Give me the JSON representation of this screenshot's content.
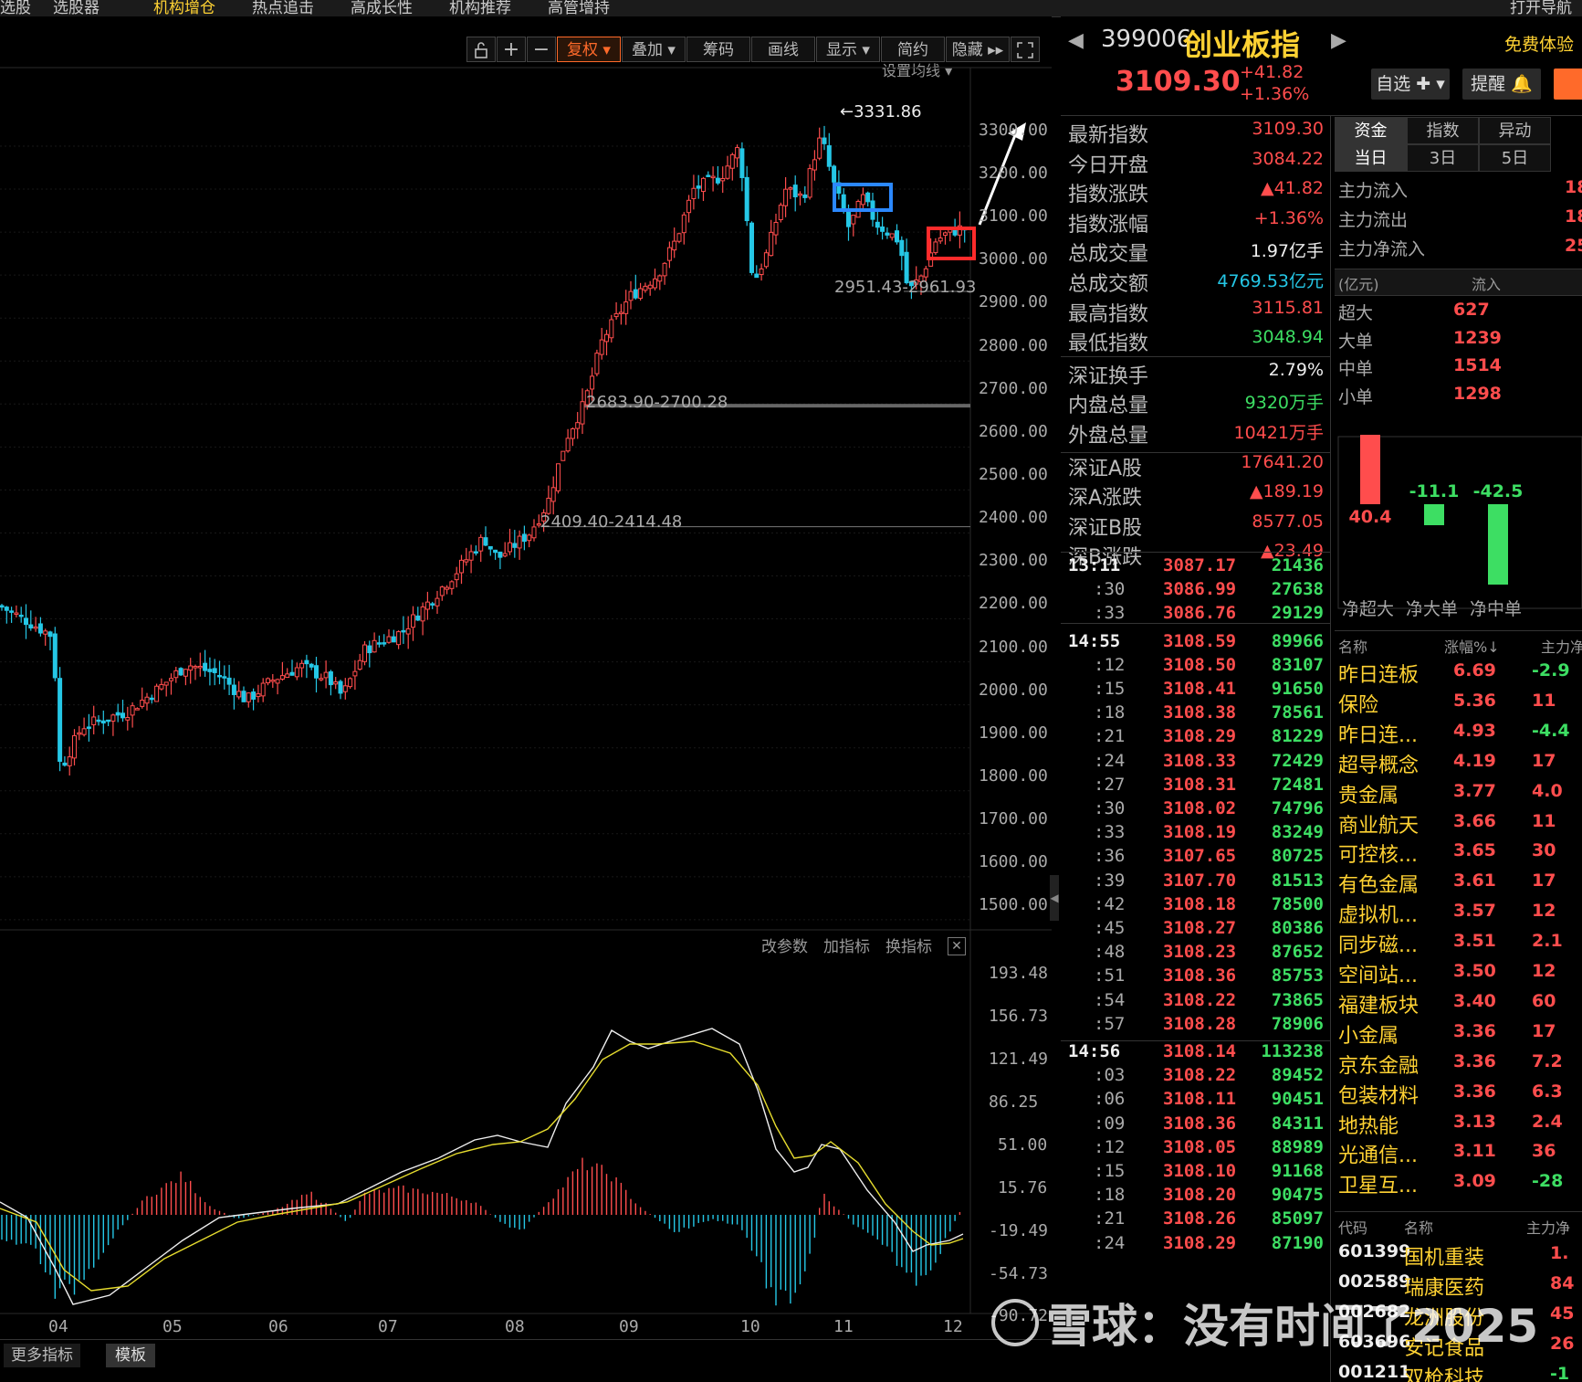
{
  "topnav": {
    "items": [
      "选股",
      "选股器",
      "机构增仓",
      "热点追击",
      "高成长性",
      "机构推荐",
      "高管增持"
    ],
    "right": "打开导航"
  },
  "toolbar": {
    "buttons": [
      "复权",
      "叠加",
      "筹码",
      "画线",
      "显示",
      "简约",
      "隐藏"
    ]
  },
  "chart": {
    "set_ma_label": "设置均线",
    "high_annot": "3331.86",
    "gap1": "2951.43-2961.93",
    "gap2": "2683.90-2700.28",
    "gap3": "2409.40-2414.48",
    "price_ticks": [
      "3300.00",
      "3200.00",
      "3100.00",
      "3000.00",
      "2900.00",
      "2800.00",
      "2700.00",
      "2600.00",
      "2500.00",
      "2400.00",
      "2300.00",
      "2200.00",
      "2100.00",
      "2000.00",
      "1900.00",
      "1800.00",
      "1700.00",
      "1600.00",
      "1500.00"
    ],
    "indicator_tools": [
      "改参数",
      "加指标",
      "换指标"
    ],
    "ind_ticks": [
      "193.48",
      "156.73",
      "121.49",
      "86.25",
      "51.00",
      "15.76",
      "-19.49",
      "-54.73",
      "-90.72"
    ],
    "months": [
      "04",
      "05",
      "06",
      "07",
      "08",
      "09",
      "10",
      "11",
      "12"
    ],
    "bottom_tabs": [
      "更多指标",
      "模板"
    ]
  },
  "header": {
    "code": "399006",
    "name": "创业板指",
    "price": "3109.30",
    "change": "+41.82",
    "change_pct": "+1.36%",
    "free_trial": "免费体验",
    "btn_watch": "自选",
    "btn_alert": "提醒"
  },
  "stats": [
    {
      "label": "最新指数",
      "value": "3109.30",
      "color": "red"
    },
    {
      "label": "今日开盘",
      "value": "3084.22",
      "color": "red"
    },
    {
      "label": "指数涨跌",
      "value": "▲41.82",
      "color": "red"
    },
    {
      "label": "指数涨幅",
      "value": "+1.36%",
      "color": "red"
    },
    {
      "label": "总成交量",
      "value": "1.97亿手",
      "color": "white"
    },
    {
      "label": "总成交额",
      "value": "4769.53亿元",
      "color": "cyan"
    },
    {
      "label": "最高指数",
      "value": "3115.81",
      "color": "red"
    },
    {
      "label": "最低指数",
      "value": "3048.94",
      "color": "green"
    },
    {
      "label": "深证换手",
      "value": "2.79%",
      "color": "white"
    },
    {
      "label": "内盘总量",
      "value": "9320万手",
      "color": "green"
    },
    {
      "label": "外盘总量",
      "value": "10421万手",
      "color": "red"
    },
    {
      "label": "深证A股",
      "value": "17641.20",
      "color": "red"
    },
    {
      "label": "深A涨跌",
      "value": "▲189.19",
      "color": "red"
    },
    {
      "label": "深证B股",
      "value": "8577.05",
      "color": "red"
    },
    {
      "label": "深B涨跌",
      "value": "▲23.49",
      "color": "red"
    }
  ],
  "ticks": [
    {
      "t": "13:11",
      "p": "3087.17",
      "v": "21436",
      "hdr": true
    },
    {
      "t": ":30",
      "p": "3086.99",
      "v": "27638"
    },
    {
      "t": ":33",
      "p": "3086.76",
      "v": "29129"
    },
    {
      "t": "14:55",
      "p": "3108.59",
      "v": "89966",
      "hdr": true
    },
    {
      "t": ":12",
      "p": "3108.50",
      "v": "83107"
    },
    {
      "t": ":15",
      "p": "3108.41",
      "v": "91650"
    },
    {
      "t": ":18",
      "p": "3108.38",
      "v": "78561"
    },
    {
      "t": ":21",
      "p": "3108.29",
      "v": "81229"
    },
    {
      "t": ":24",
      "p": "3108.33",
      "v": "72429"
    },
    {
      "t": ":27",
      "p": "3108.31",
      "v": "72481"
    },
    {
      "t": ":30",
      "p": "3108.02",
      "v": "74796"
    },
    {
      "t": ":33",
      "p": "3108.19",
      "v": "83249"
    },
    {
      "t": ":36",
      "p": "3107.65",
      "v": "80725"
    },
    {
      "t": ":39",
      "p": "3107.70",
      "v": "81513"
    },
    {
      "t": ":42",
      "p": "3108.18",
      "v": "78500"
    },
    {
      "t": ":45",
      "p": "3108.27",
      "v": "80386"
    },
    {
      "t": ":48",
      "p": "3108.23",
      "v": "87652"
    },
    {
      "t": ":51",
      "p": "3108.36",
      "v": "85753"
    },
    {
      "t": ":54",
      "p": "3108.22",
      "v": "73865"
    },
    {
      "t": ":57",
      "p": "3108.28",
      "v": "78906"
    },
    {
      "t": "14:56",
      "p": "3108.14",
      "v": "113238",
      "hdr": true
    },
    {
      "t": ":03",
      "p": "3108.22",
      "v": "89452"
    },
    {
      "t": ":06",
      "p": "3108.11",
      "v": "90451"
    },
    {
      "t": ":09",
      "p": "3108.36",
      "v": "84311"
    },
    {
      "t": ":12",
      "p": "3108.05",
      "v": "88989"
    },
    {
      "t": ":15",
      "p": "3108.10",
      "v": "91168"
    },
    {
      "t": ":18",
      "p": "3108.20",
      "v": "90475"
    },
    {
      "t": ":21",
      "p": "3108.26",
      "v": "85097"
    },
    {
      "t": ":24",
      "p": "3108.29",
      "v": "87190"
    }
  ],
  "fund": {
    "tabs": [
      "资金",
      "指数",
      "异动"
    ],
    "period_tabs": [
      "当日",
      "3日",
      "5日"
    ],
    "flow_rows": [
      {
        "label": "主力流入",
        "value": "18"
      },
      {
        "label": "主力流出",
        "value": "18"
      },
      {
        "label": "主力净流入",
        "value": "25"
      }
    ],
    "unit_hdr": "(亿元)",
    "in_hdr": "流入",
    "size_rows": [
      {
        "label": "超大",
        "value": "627"
      },
      {
        "label": "大单",
        "value": "1239"
      },
      {
        "label": "中单",
        "value": "1514"
      },
      {
        "label": "小单",
        "value": "1298"
      }
    ],
    "bars": [
      {
        "label": "净超大",
        "value": 40.4,
        "text": "40.4"
      },
      {
        "label": "净大单",
        "value": -11.1,
        "text": "-11.1"
      },
      {
        "label": "净中单",
        "value": -42.5,
        "text": "-42.5"
      }
    ]
  },
  "sectors": {
    "headers": [
      "名称",
      "涨幅%↓",
      "主力净"
    ],
    "rows": [
      {
        "name": "昨日连板",
        "pct": "6.69",
        "net": "-2.9"
      },
      {
        "name": "保险",
        "pct": "5.36",
        "net": "11"
      },
      {
        "name": "昨日连...",
        "pct": "4.93",
        "net": "-4.4"
      },
      {
        "name": "超导概念",
        "pct": "4.19",
        "net": "17"
      },
      {
        "name": "贵金属",
        "pct": "3.77",
        "net": "4.0"
      },
      {
        "name": "商业航天",
        "pct": "3.66",
        "net": "11"
      },
      {
        "name": "可控核...",
        "pct": "3.65",
        "net": "30"
      },
      {
        "name": "有色金属",
        "pct": "3.61",
        "net": "17"
      },
      {
        "name": "虚拟机...",
        "pct": "3.57",
        "net": "12"
      },
      {
        "name": "同步磁...",
        "pct": "3.51",
        "net": "2.1"
      },
      {
        "name": "空间站...",
        "pct": "3.50",
        "net": "12"
      },
      {
        "name": "福建板块",
        "pct": "3.40",
        "net": "60"
      },
      {
        "name": "小金属",
        "pct": "3.36",
        "net": "17"
      },
      {
        "name": "京东金融",
        "pct": "3.36",
        "net": "7.2"
      },
      {
        "name": "包装材料",
        "pct": "3.36",
        "net": "6.3"
      },
      {
        "name": "地热能",
        "pct": "3.13",
        "net": "2.4"
      },
      {
        "name": "光通信...",
        "pct": "3.11",
        "net": "36"
      },
      {
        "name": "卫星互...",
        "pct": "3.09",
        "net": "-28"
      }
    ]
  },
  "stocks": {
    "headers": [
      "代码",
      "名称",
      "主力净"
    ],
    "rows": [
      {
        "code": "601399",
        "name": "国机重装",
        "net": "1."
      },
      {
        "code": "002589",
        "name": "瑞康医药",
        "net": "84"
      },
      {
        "code": "002682",
        "name": "龙洲股份",
        "net": "45"
      },
      {
        "code": "603696",
        "name": "安记食品",
        "net": "26"
      },
      {
        "code": "001211",
        "name": "双枪科技",
        "net": "-1"
      }
    ]
  },
  "watermark": "雪球：没有时间了2025"
}
